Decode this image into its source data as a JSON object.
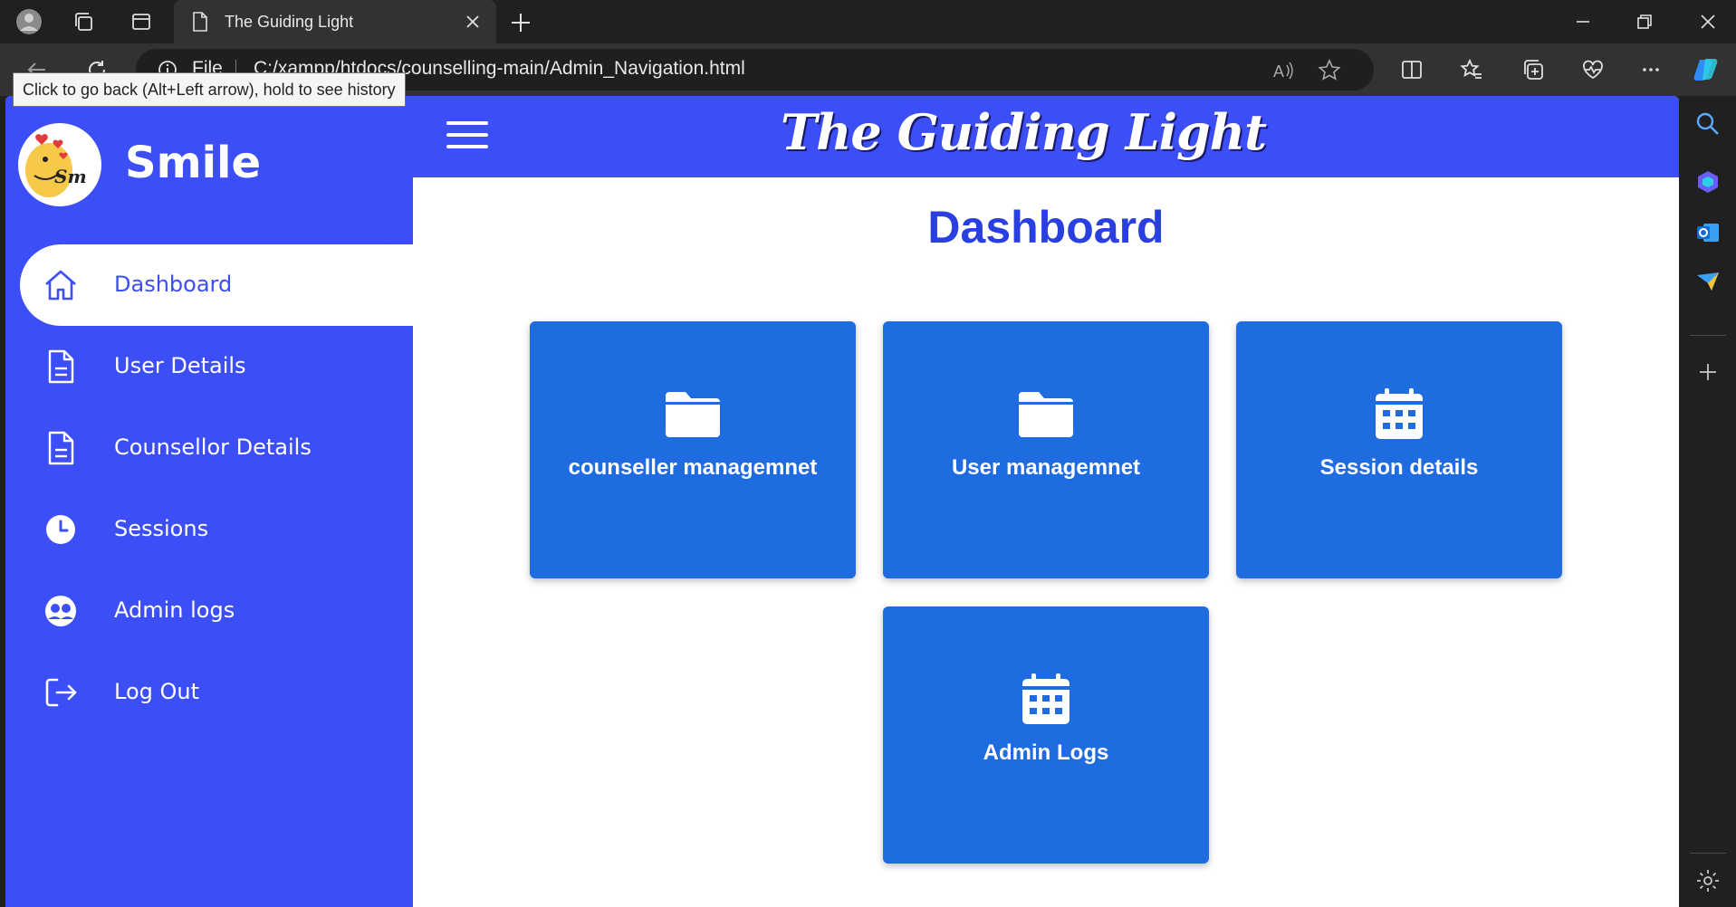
{
  "browser": {
    "tab_title": "The Guiding Light",
    "url_scheme_label": "File",
    "url": "C:/xampp/htdocs/counselling-main/Admin_Navigation.html",
    "tooltip": "Click to go back (Alt+Left arrow), hold to see history"
  },
  "page": {
    "site_title": "The Guiding Light",
    "brand_name": "Smile",
    "heading": "Dashboard"
  },
  "sidebar": {
    "items": [
      {
        "label": "Dashboard",
        "icon": "home-icon",
        "active": true
      },
      {
        "label": "User Details",
        "icon": "document-icon"
      },
      {
        "label": "Counsellor Details",
        "icon": "document-icon"
      },
      {
        "label": "Sessions",
        "icon": "clock-icon"
      },
      {
        "label": "Admin logs",
        "icon": "users-icon"
      },
      {
        "label": "Log Out",
        "icon": "logout-icon"
      }
    ]
  },
  "cards": [
    {
      "label": "counseller managemnet",
      "icon": "folder-icon"
    },
    {
      "label": "User managemnet",
      "icon": "folder-icon"
    },
    {
      "label": "Session details",
      "icon": "calendar-icon"
    },
    {
      "label": "Admin Logs",
      "icon": "calendar-icon"
    }
  ],
  "colors": {
    "primary": "#3c4ef5",
    "card": "#1f6be0",
    "heading": "#2a3fe0"
  }
}
